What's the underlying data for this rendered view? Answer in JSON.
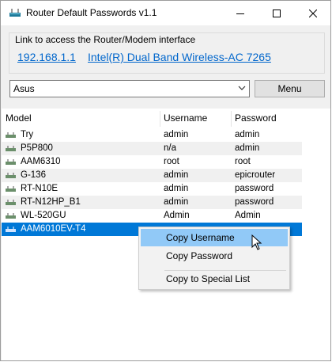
{
  "window": {
    "title": "Router Default Passwords v1.1"
  },
  "group": {
    "caption": "Link to access the Router/Modem interface",
    "ip_link": "192.168.1.1",
    "adapter_link": "Intel(R) Dual Band Wireless-AC 7265"
  },
  "brand_select": {
    "value": "Asus"
  },
  "menu_button": "Menu",
  "columns": [
    "Model",
    "Username",
    "Password"
  ],
  "rows": [
    {
      "model": "Try",
      "username": "admin",
      "password": "admin"
    },
    {
      "model": "P5P800",
      "username": "n/a",
      "password": "admin"
    },
    {
      "model": "AAM6310",
      "username": "root",
      "password": "root"
    },
    {
      "model": "G-136",
      "username": "admin",
      "password": "epicrouter"
    },
    {
      "model": "RT-N10E",
      "username": "admin",
      "password": "password"
    },
    {
      "model": "RT-N12HP_B1",
      "username": "admin",
      "password": "password"
    },
    {
      "model": "WL-520GU",
      "username": "Admin",
      "password": "Admin"
    },
    {
      "model": "AAM6010EV-T4",
      "username": "",
      "password": ""
    }
  ],
  "context_menu": {
    "items": [
      "Copy Username",
      "Copy Password",
      "Copy to Special List"
    ]
  },
  "colors": {
    "accent": "#0078d7",
    "link": "#0066cc",
    "menu_hover": "#91c9f7"
  },
  "icons": [
    "router-icon",
    "minimize-icon",
    "maximize-icon",
    "close-icon",
    "chevron-down-icon",
    "cursor-icon"
  ]
}
